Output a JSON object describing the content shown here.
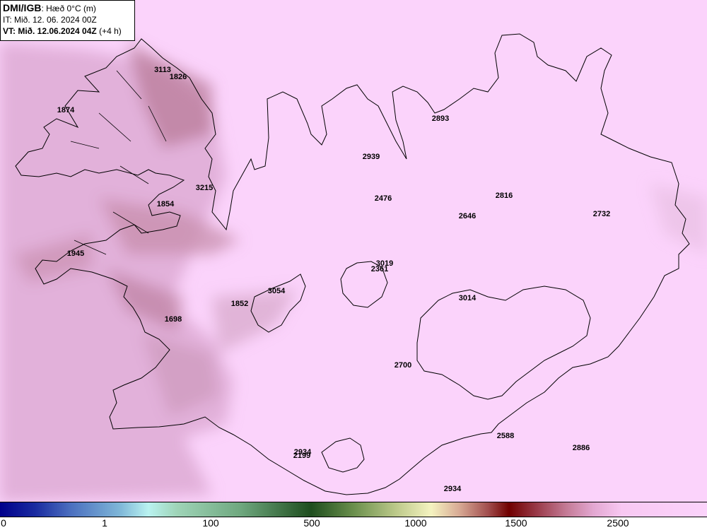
{
  "header": {
    "brand": "DMI/IGB",
    "parameter": ": Hæð 0°C (m)",
    "init_time": "IT: Mið. 12. 06. 2024 00Z",
    "valid_label": "VT: Mið. 12.06.2024 04Z",
    "valid_offset": " (+4 h)"
  },
  "labels": [
    "3113",
    "1826",
    "1874",
    "3215",
    "1854",
    "1945",
    "3054",
    "1852",
    "1698",
    "2939",
    "2893",
    "2476",
    "2816",
    "2646",
    "2732",
    "3019",
    "2361",
    "3014",
    "2700",
    "2588",
    "2886",
    "2934",
    "2199",
    "2934"
  ],
  "colorbar": {
    "ticks": [
      "0",
      "1",
      "100",
      "500",
      "1000",
      "1500",
      "2500"
    ]
  },
  "colors": {
    "background": "#fbd3fb",
    "coast": "#000000"
  }
}
